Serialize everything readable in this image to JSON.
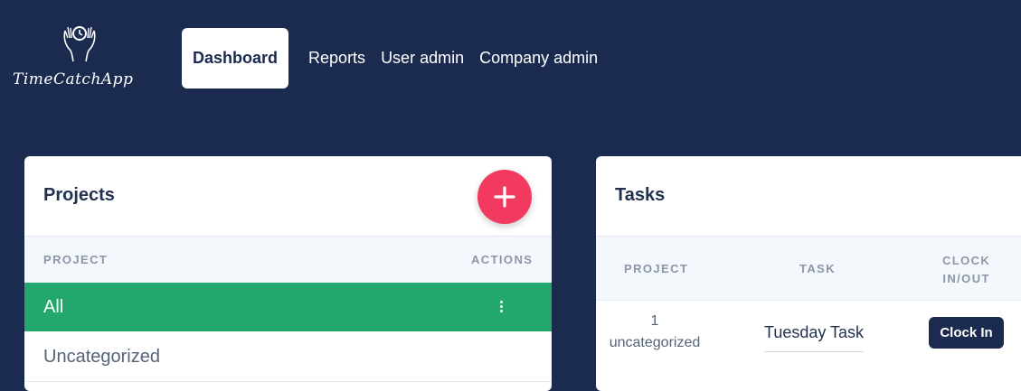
{
  "app": {
    "logo_text": "TimeCatchApp"
  },
  "nav": {
    "items": [
      "Dashboard",
      "Reports",
      "User admin",
      "Company admin"
    ],
    "active": "Dashboard"
  },
  "projects": {
    "title": "Projects",
    "add_label": "+",
    "columns": {
      "project": "PROJECT",
      "actions": "ACTIONS"
    },
    "rows": [
      {
        "name": "All",
        "selected": true
      },
      {
        "name": "Uncategorized",
        "selected": false
      }
    ]
  },
  "tasks": {
    "title": "Tasks",
    "columns": {
      "project": "PROJECT",
      "task": "TASK",
      "clock_line1": "CLOCK",
      "clock_line2": "IN/OUT"
    },
    "rows": [
      {
        "project_line1": "1",
        "project_line2": "uncategorized",
        "task": "Tuesday Task",
        "action": "Clock In"
      }
    ]
  },
  "colors": {
    "navy": "#1b2b4f",
    "accent_red": "#f2395f",
    "selected_green": "#24a76d"
  }
}
